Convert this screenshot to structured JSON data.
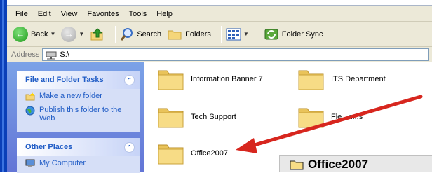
{
  "menu": [
    "File",
    "Edit",
    "View",
    "Favorites",
    "Tools",
    "Help"
  ],
  "toolbar": {
    "back_label": "Back",
    "search_label": "Search",
    "folders_label": "Folders",
    "folder_sync_label": "Folder Sync"
  },
  "address": {
    "label": "Address",
    "value": "S:\\"
  },
  "tasks_panel": {
    "title": "File and Folder Tasks",
    "items": [
      "Make a new folder",
      "Publish this folder to the Web"
    ]
  },
  "places_panel": {
    "title": "Other Places",
    "items": [
      "My Computer"
    ]
  },
  "folders": [
    {
      "name": "Information Banner 7"
    },
    {
      "name": "ITS Department"
    },
    {
      "name": "Tech Support"
    },
    {
      "name": "Fle...n...s"
    },
    {
      "name": "Office2007"
    }
  ],
  "inlay": {
    "label": "Office2007"
  },
  "colors": {
    "arrow": "#d7261e",
    "link": "#215dc6",
    "folder": "#f5d67a"
  }
}
